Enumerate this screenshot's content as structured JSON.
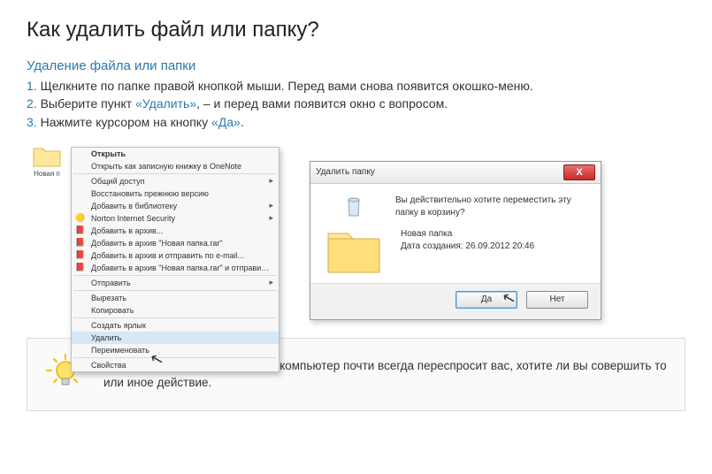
{
  "page": {
    "title": "Как удалить файл или папку?",
    "subtitle": "Удаление файла или папки",
    "steps": [
      {
        "num": "1.",
        "text": "Щелкните по папке правой кнопкой мыши. Перед вами снова появится окошко-меню."
      },
      {
        "num": "2.",
        "pre": "Выберите пункт ",
        "kw": "«Удалить»",
        "post": ", – и перед вами появится окно с вопросом."
      },
      {
        "num": "3.",
        "pre": "Нажмите курсором на кнопку ",
        "kw": "«Да»",
        "post": "."
      }
    ]
  },
  "folder_label": "Новая п",
  "context_menu": {
    "open": "Открыть",
    "onenote": "Открыть как записную книжку в OneNote",
    "share": "Общий доступ",
    "restore": "Восстановить прежнюю версию",
    "add_lib": "Добавить в библиотеку",
    "norton": "Norton Internet Security",
    "add_arch": "Добавить в архив...",
    "add_arch_named": "Добавить в архив \"Новая папка.rar\"",
    "add_send": "Добавить в архив и отправить по e-mail...",
    "add_named_send": "Добавить в архив \"Новая папка.rar\" и отправить по e-mail",
    "send": "Отправить",
    "cut": "Вырезать",
    "copy": "Копировать",
    "shortcut": "Создать ярлык",
    "delete": "Удалить",
    "rename": "Переименовать",
    "props": "Свойства"
  },
  "dialog": {
    "title": "Удалить папку",
    "question": "Вы действительно хотите переместить эту папку в корзину?",
    "folder_name": "Новая папка",
    "date_label": "Дата создания: 26.09.2012 20:46",
    "yes": "Да",
    "no": "Нет"
  },
  "tip": {
    "text": "Чтобы избежать случайностей, компьютер почти всегда переспросит вас, хотите ли вы совершить то или иное действие."
  }
}
